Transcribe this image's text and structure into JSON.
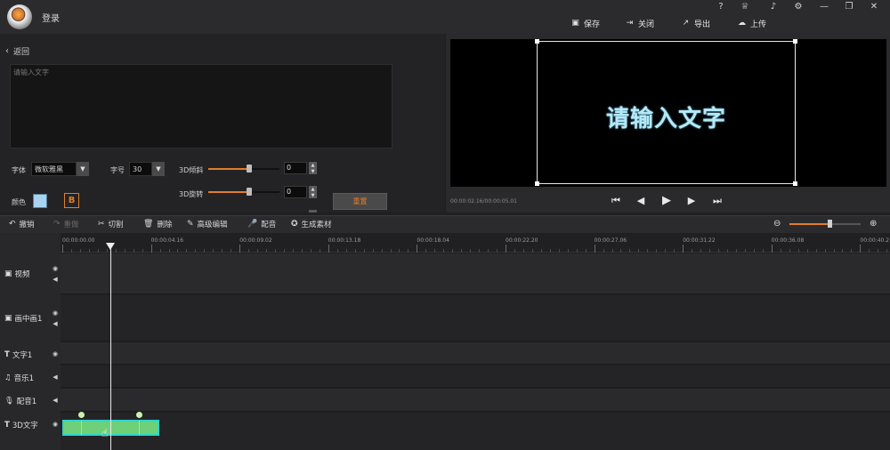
{
  "header": {
    "login_label": "登录",
    "window_buttons": [
      "?",
      "♕",
      "🔔",
      "⚙",
      "—",
      "▭",
      "✕"
    ],
    "actions": [
      {
        "label": "保存",
        "icon": "save-icon",
        "glyph": "▣"
      },
      {
        "label": "关闭",
        "icon": "close-icon",
        "glyph": "⇥"
      },
      {
        "label": "导出",
        "icon": "export-icon",
        "glyph": "↗"
      },
      {
        "label": "上传",
        "icon": "upload-icon",
        "glyph": "☁"
      }
    ]
  },
  "editor": {
    "back_label": "返回",
    "text_placeholder": "请输入文字",
    "font_label": "字体",
    "font_value": "微软雅黑",
    "size_label": "字号",
    "size_value": "30",
    "tilt_label": "3D倾斜",
    "tilt_value": "0",
    "rotate_label": "3D旋转",
    "rotate_value": "0",
    "tilt_slider_level": 0.58,
    "rotate_slider_level": 0.58,
    "color_label": "颜色",
    "color_value": "#a8d4f2",
    "bold_label": "B",
    "reset_label": "重置"
  },
  "preview": {
    "text": "请输入文字",
    "timecode": "00:00:02.16/00:00:05.01",
    "controls": [
      "skip-back-icon",
      "step-back-icon",
      "play-icon",
      "step-forward-icon",
      "skip-forward-icon"
    ]
  },
  "toolbar": {
    "undo": "撤销",
    "redo": "重做",
    "cut": "切割",
    "delete": "删除",
    "advanced_edit": "高级编辑",
    "dub": "配音",
    "generate": "生成素材",
    "zoom_level": 0.58
  },
  "ruler": {
    "ticks": [
      "00:00:00.00",
      "00:00:04.16",
      "00:00:09.02",
      "00:00:13.18",
      "00:00:18.04",
      "00:00:22.20",
      "00:00:27.06",
      "00:00:31.22",
      "00:00:36.08",
      "00:00:40.2"
    ]
  },
  "tracks": [
    {
      "label": "视频",
      "icon": "video-icon"
    },
    {
      "label": "画中画1",
      "icon": "pip-icon"
    },
    {
      "label": "文字1",
      "icon": "text-icon"
    },
    {
      "label": "音乐1",
      "icon": "music-icon"
    },
    {
      "label": "配音1",
      "icon": "mic-icon"
    },
    {
      "label": "3D文字",
      "icon": "text-3d-icon"
    }
  ]
}
